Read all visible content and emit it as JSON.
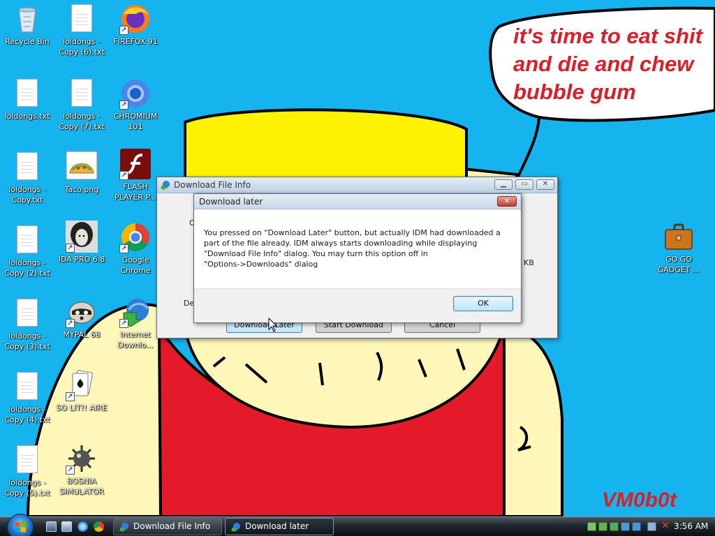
{
  "wallpaper": {
    "speech_bubble_text": [
      "it's time to eat shit",
      "and die and chew",
      "bubble gum"
    ],
    "signature": "VM0b0t"
  },
  "desktop_icons": [
    {
      "label": "Recycle Bin",
      "icon": "recycle-bin-icon"
    },
    {
      "label": "loldongs - Copy (6).txt",
      "icon": "text-file-icon"
    },
    {
      "label": "FIREFOX 91",
      "icon": "firefox-icon"
    },
    {
      "label": "loldongs.txt",
      "icon": "text-file-icon"
    },
    {
      "label": "loldongs - Copy (7).txt",
      "icon": "text-file-icon"
    },
    {
      "label": "CHROMIUM 101",
      "icon": "chromium-icon"
    },
    {
      "label": "loldongs - Copy.txt",
      "icon": "text-file-icon"
    },
    {
      "label": "Taco.png",
      "icon": "taco-image-icon"
    },
    {
      "label": "FLASH PLAYER P...",
      "icon": "flash-player-icon"
    },
    {
      "label": "loldongs - Copy (2).txt",
      "icon": "text-file-icon"
    },
    {
      "label": "IDA PRO 6.8",
      "icon": "ida-pro-icon"
    },
    {
      "label": "Google Chrome",
      "icon": "chrome-icon"
    },
    {
      "label": "loldongs - Copy (3).txt",
      "icon": "text-file-icon"
    },
    {
      "label": "MYPAL 68",
      "icon": "mypal-raccoon-icon"
    },
    {
      "label": "Internet Downlo...",
      "icon": "idm-icon"
    },
    {
      "label": "loldongs - Copy (4).txt",
      "icon": "text-file-icon"
    },
    {
      "label": "SO LIT!! AIRE",
      "icon": "solitaire-cards-icon"
    },
    {
      "label": "loldongs - Copy (5).txt",
      "icon": "text-file-icon"
    },
    {
      "label": "BOSNIA SIMULATOR",
      "icon": "minesweeper-mine-icon"
    },
    {
      "label": "GO GO GADGET ...",
      "icon": "briefcase-icon"
    }
  ],
  "download_info_window": {
    "title": "Download File Info",
    "partial_labels": {
      "o": "O",
      "des": "Des",
      "kb": "KB"
    },
    "buttons": {
      "download_later": "Download Later",
      "start_download": "Start Download",
      "cancel": "Cancel"
    }
  },
  "download_later_dialog": {
    "title": "Download later",
    "message_lines": [
      "You pressed on \"Download Later\" button, but actually IDM had downloaded a",
      "part of the file already. IDM always starts downloading while displaying",
      "\"Download File Info\" dialog. You may turn this option off in",
      "\"Options->Downloads\" dialog"
    ],
    "ok_label": "OK",
    "close_glyph": "✕"
  },
  "taskbar": {
    "tasks": [
      {
        "label": "Download File Info",
        "icon": "idm-icon"
      },
      {
        "label": "Download later",
        "icon": "idm-icon"
      }
    ],
    "clock": "3:56 AM"
  },
  "colors": {
    "desktop": "#16b4ee",
    "bubble_text": "#d8202a",
    "shirt_red": "#e4192a",
    "hat_yellow": "#fff200",
    "skin": "#fef7b9",
    "dialog_accent": "#c0392b"
  }
}
